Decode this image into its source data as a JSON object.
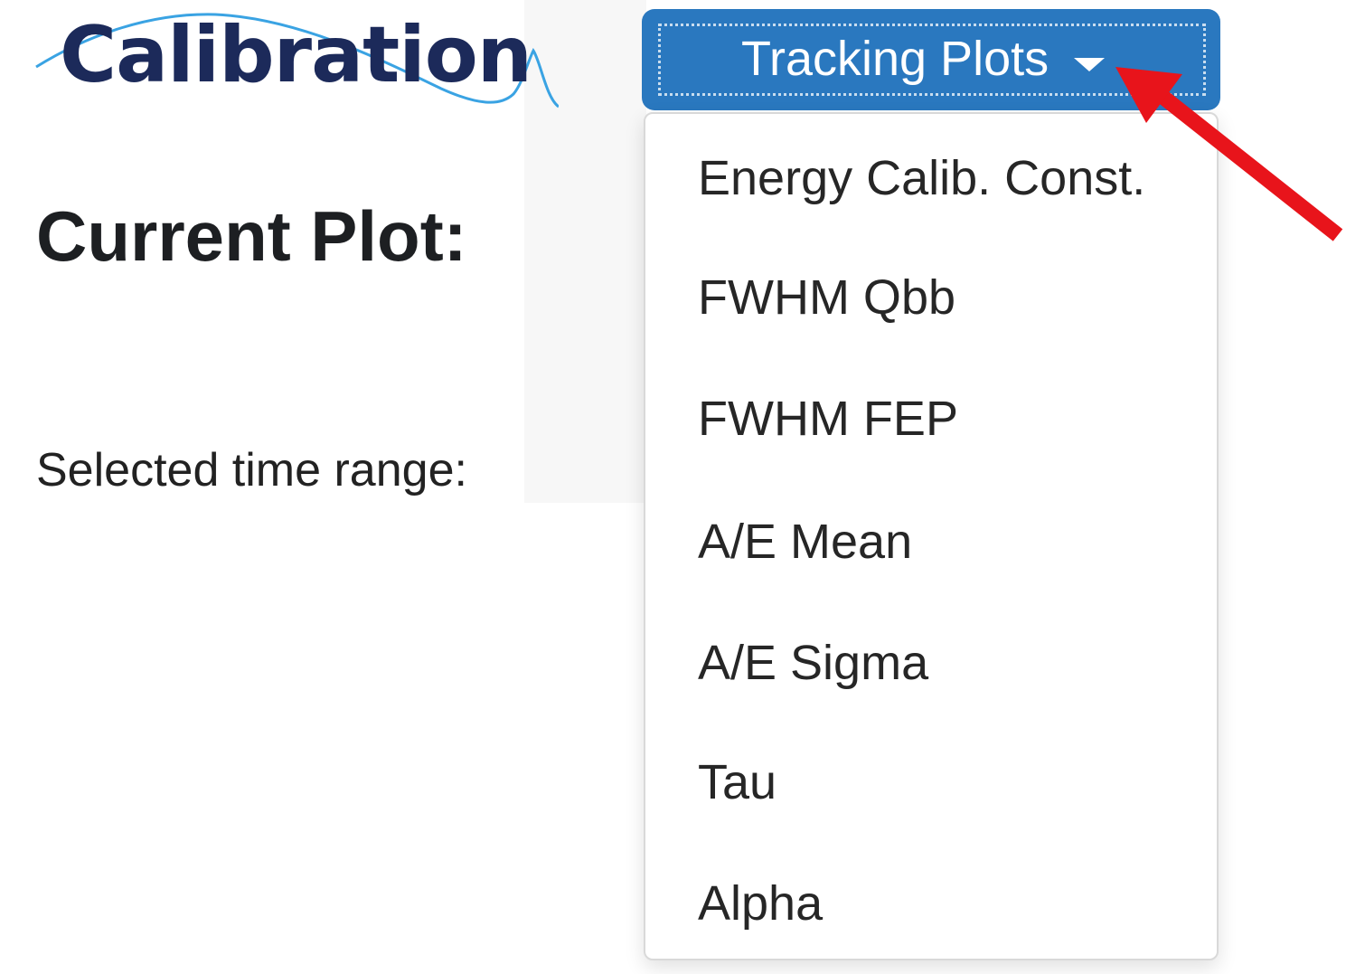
{
  "logo": {
    "text": "Calibration"
  },
  "main": {
    "heading": "Current Plot:",
    "time_range_label": "Selected time range:"
  },
  "dropdown": {
    "label": "Tracking Plots",
    "items": [
      {
        "label": "Energy Calib. Const."
      },
      {
        "label": "FWHM Qbb"
      },
      {
        "label": "FWHM FEP"
      },
      {
        "label": "A/E Mean"
      },
      {
        "label": "A/E Sigma"
      },
      {
        "label": "Tau"
      },
      {
        "label": "Alpha"
      }
    ]
  },
  "colors": {
    "button_bg": "#2a78bf",
    "logo_text": "#1c2a5a",
    "logo_wave": "#3aa3e3",
    "annotation_arrow": "#e8141b"
  },
  "icons": {
    "caret": "caret-down-icon",
    "annotation": "red-arrow-annotation"
  }
}
